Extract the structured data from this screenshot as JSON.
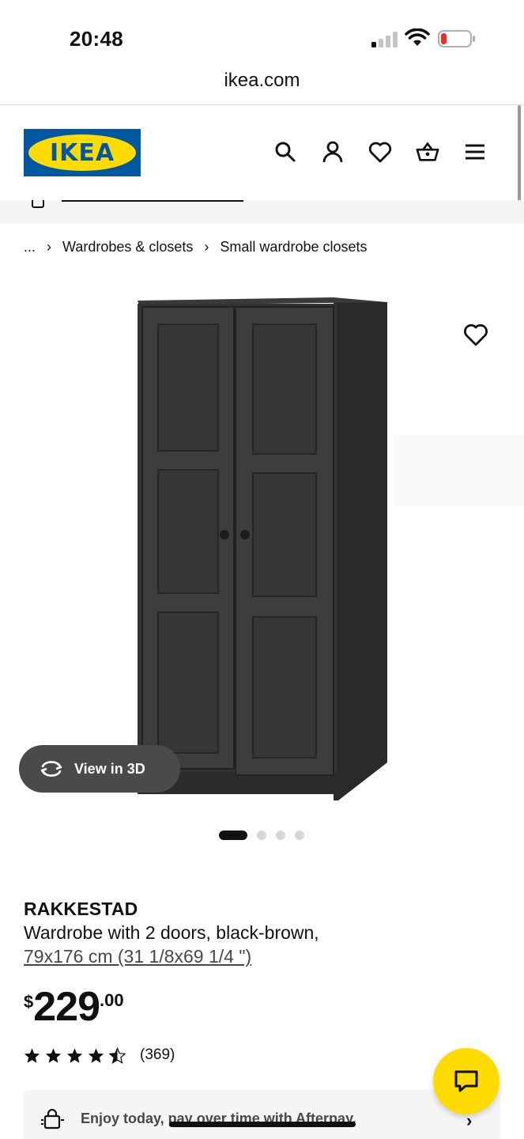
{
  "status_bar": {
    "time": "20:48"
  },
  "browser": {
    "url": "ikea.com"
  },
  "header": {
    "logo_text": "IKEA",
    "icons": [
      "search-icon",
      "account-icon",
      "favorites-icon",
      "cart-icon",
      "menu-icon"
    ]
  },
  "breadcrumb": {
    "ellipsis": "...",
    "items": [
      "Wardrobes & closets",
      "Small wardrobe closets"
    ]
  },
  "gallery": {
    "view_3d_label": "View in 3D",
    "image_count": 4,
    "active_index": 0
  },
  "product": {
    "name": "RAKKESTAD",
    "description": "Wardrobe with 2 doors, black-brown,",
    "size": "79x176 cm (31 1/8x69 1/4 \")",
    "price": {
      "currency": "$",
      "integer": "229",
      "decimal": ".00"
    },
    "rating": {
      "value": 4.5,
      "max": 5,
      "review_count": "(369)"
    }
  },
  "afterpay": {
    "text": "Enjoy today, pay over time with Afterpay."
  },
  "colors": {
    "ikea_blue": "#0058a3",
    "ikea_yellow": "#ffdb00",
    "dark_button": "#4a4a4a"
  }
}
